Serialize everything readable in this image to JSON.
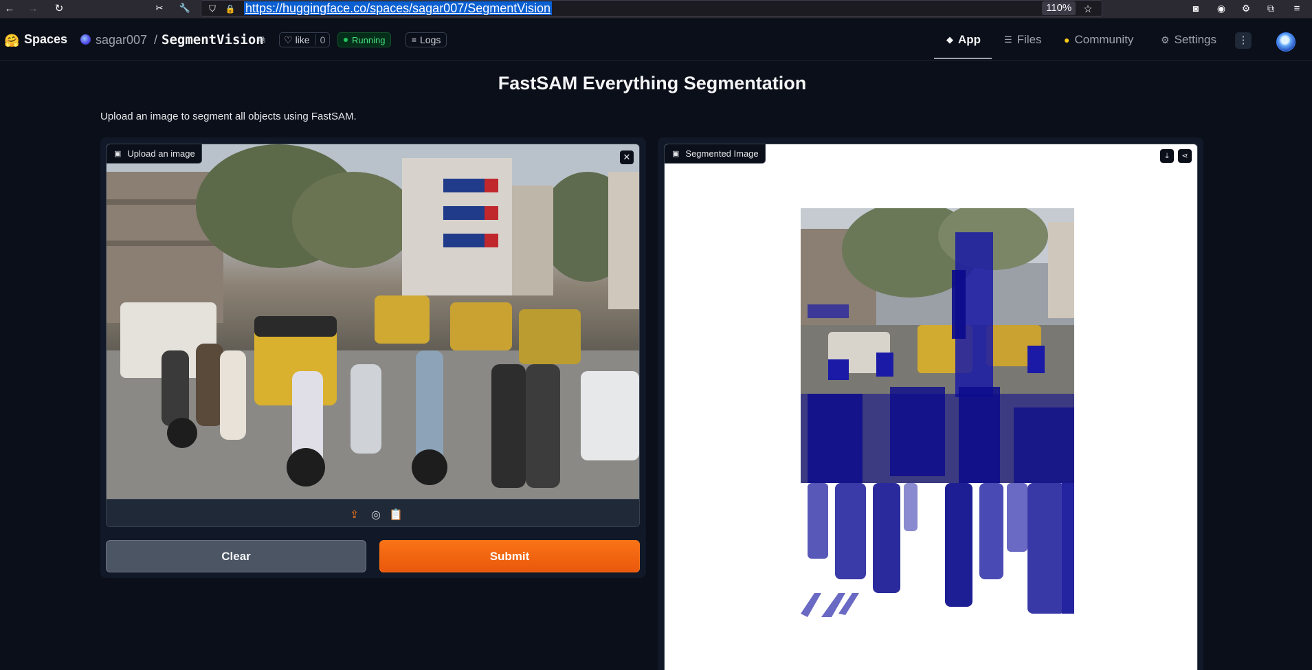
{
  "browser": {
    "url": "https://huggingface.co/spaces/sagar007/SegmentVision",
    "zoom": "110%"
  },
  "header": {
    "logo": "🤗",
    "spaces_label": "Spaces",
    "owner": "sagar007",
    "separator": "/",
    "repo": "SegmentVision",
    "like_label": "like",
    "like_count": "0",
    "status": "Running",
    "logs_label": "Logs",
    "nav": {
      "app": "App",
      "files": "Files",
      "community": "Community",
      "settings": "Settings"
    }
  },
  "main": {
    "title": "FastSAM Everything Segmentation",
    "description": "Upload an image to segment all objects using FastSAM.",
    "input_label": "Upload an image",
    "output_label": "Segmented Image",
    "clear_label": "Clear",
    "submit_label": "Submit"
  },
  "colors": {
    "accent": "#f97316",
    "mask": "#0a0a8c",
    "background": "#0b0f19"
  }
}
